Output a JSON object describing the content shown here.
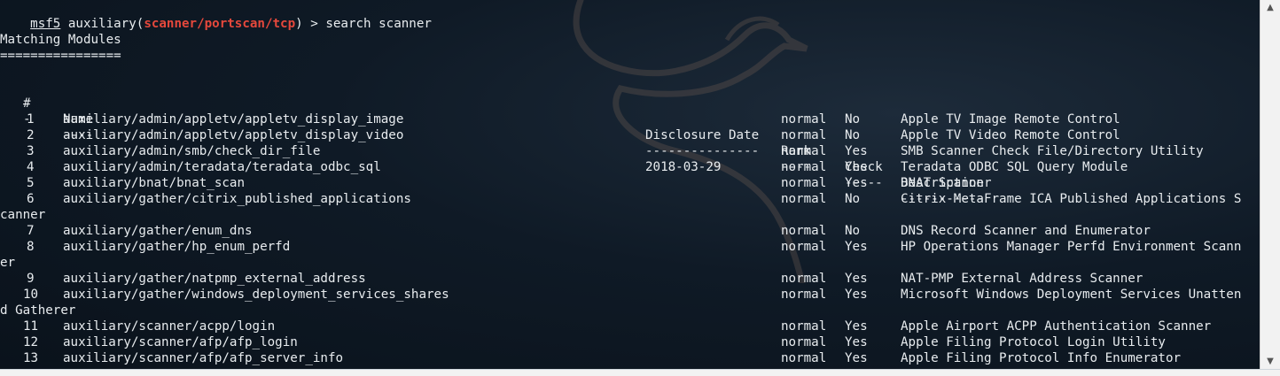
{
  "prompt": {
    "user": "msf5",
    "module_prefix": " auxiliary(",
    "module": "scanner/portscan/tcp",
    "module_suffix": ") > ",
    "command": "search scanner"
  },
  "heading": "Matching Modules",
  "underline": "================",
  "columns": {
    "num": "#",
    "name": "Name",
    "date": "Disclosure Date",
    "rank": "Rank",
    "check": "Check",
    "desc": "Description"
  },
  "dashes": {
    "num": "-",
    "name": "----",
    "date": "---------------",
    "rank": "----",
    "check": "-----",
    "desc": "-----------"
  },
  "rows": [
    {
      "num": "1",
      "name": "auxiliary/admin/appletv/appletv_display_image",
      "date": "",
      "rank": "normal",
      "check": "No",
      "desc": "Apple TV Image Remote Control"
    },
    {
      "num": "2",
      "name": "auxiliary/admin/appletv/appletv_display_video",
      "date": "",
      "rank": "normal",
      "check": "No",
      "desc": "Apple TV Video Remote Control"
    },
    {
      "num": "3",
      "name": "auxiliary/admin/smb/check_dir_file",
      "date": "",
      "rank": "normal",
      "check": "Yes",
      "desc": "SMB Scanner Check File/Directory Utility"
    },
    {
      "num": "4",
      "name": "auxiliary/admin/teradata/teradata_odbc_sql",
      "date": "2018-03-29",
      "rank": "normal",
      "check": "Yes",
      "desc": "Teradata ODBC SQL Query Module"
    },
    {
      "num": "5",
      "name": "auxiliary/bnat/bnat_scan",
      "date": "",
      "rank": "normal",
      "check": "Yes",
      "desc": "BNAT Scanner"
    },
    {
      "num": "6",
      "name": "auxiliary/gather/citrix_published_applications",
      "date": "",
      "rank": "normal",
      "check": "No",
      "desc": "Citrix MetaFrame ICA Published Applications S",
      "wrap": "canner"
    },
    {
      "num": "7",
      "name": "auxiliary/gather/enum_dns",
      "date": "",
      "rank": "normal",
      "check": "No",
      "desc": "DNS Record Scanner and Enumerator"
    },
    {
      "num": "8",
      "name": "auxiliary/gather/hp_enum_perfd",
      "date": "",
      "rank": "normal",
      "check": "Yes",
      "desc": "HP Operations Manager Perfd Environment Scann",
      "wrap": "er"
    },
    {
      "num": "9",
      "name": "auxiliary/gather/natpmp_external_address",
      "date": "",
      "rank": "normal",
      "check": "Yes",
      "desc": "NAT-PMP External Address Scanner"
    },
    {
      "num": "10",
      "name": "auxiliary/gather/windows_deployment_services_shares",
      "date": "",
      "rank": "normal",
      "check": "Yes",
      "desc": "Microsoft Windows Deployment Services Unatten",
      "wrap": "d Gatherer"
    },
    {
      "num": "11",
      "name": "auxiliary/scanner/acpp/login",
      "date": "",
      "rank": "normal",
      "check": "Yes",
      "desc": "Apple Airport ACPP Authentication Scanner"
    },
    {
      "num": "12",
      "name": "auxiliary/scanner/afp/afp_login",
      "date": "",
      "rank": "normal",
      "check": "Yes",
      "desc": "Apple Filing Protocol Login Utility"
    },
    {
      "num": "13",
      "name": "auxiliary/scanner/afp/afp_server_info",
      "date": "",
      "rank": "normal",
      "check": "Yes",
      "desc": "Apple Filing Protocol Info Enumerator"
    }
  ],
  "scrollbar": {
    "up_icon": "triangle-up",
    "down_icon": "triangle-down"
  }
}
